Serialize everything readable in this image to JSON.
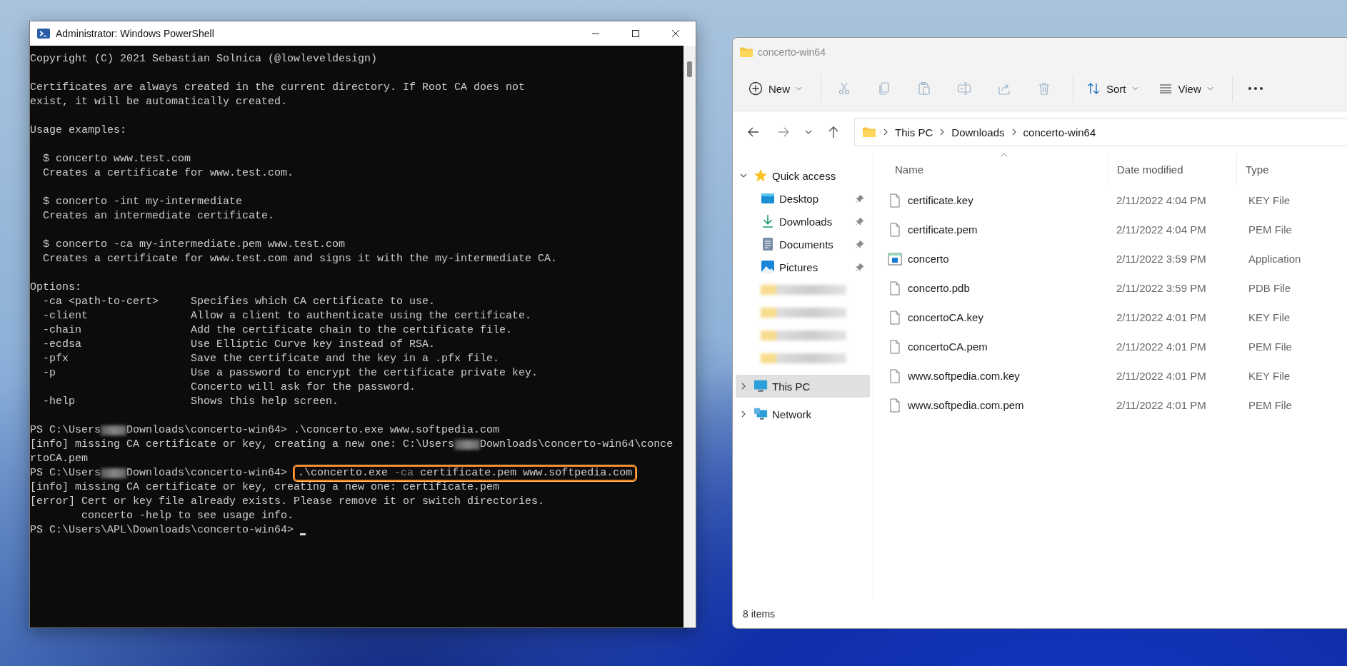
{
  "terminal": {
    "title": "Administrator: Windows PowerShell",
    "lines": [
      {
        "kind": "text",
        "parts": [
          {
            "kind": "text",
            "text": "Copyright (C) 2021 Sebastian Solnica (@lowleveldesign)"
          }
        ]
      },
      {
        "kind": "blank"
      },
      {
        "kind": "text",
        "parts": [
          {
            "kind": "text",
            "text": "Certificates are always created in the current directory. If Root CA does not"
          }
        ]
      },
      {
        "kind": "text",
        "parts": [
          {
            "kind": "text",
            "text": "exist, it will be automatically created."
          }
        ]
      },
      {
        "kind": "blank"
      },
      {
        "kind": "text",
        "parts": [
          {
            "kind": "text",
            "text": "Usage examples:"
          }
        ]
      },
      {
        "kind": "blank"
      },
      {
        "kind": "text",
        "parts": [
          {
            "kind": "text",
            "text": "  $ concerto www.test.com"
          }
        ]
      },
      {
        "kind": "text",
        "parts": [
          {
            "kind": "text",
            "text": "  Creates a certificate for www.test.com."
          }
        ]
      },
      {
        "kind": "blank"
      },
      {
        "kind": "text",
        "parts": [
          {
            "kind": "text",
            "text": "  $ concerto -int my-intermediate"
          }
        ]
      },
      {
        "kind": "text",
        "parts": [
          {
            "kind": "text",
            "text": "  Creates an intermediate certificate."
          }
        ]
      },
      {
        "kind": "blank"
      },
      {
        "kind": "text",
        "parts": [
          {
            "kind": "text",
            "text": "  $ concerto -ca my-intermediate.pem www.test.com"
          }
        ]
      },
      {
        "kind": "text",
        "parts": [
          {
            "kind": "text",
            "text": "  Creates a certificate for www.test.com and signs it with the my-intermediate CA."
          }
        ]
      },
      {
        "kind": "blank"
      },
      {
        "kind": "text",
        "parts": [
          {
            "kind": "text",
            "text": "Options:"
          }
        ]
      },
      {
        "kind": "text",
        "parts": [
          {
            "kind": "text",
            "text": "  -ca <path-to-cert>     Specifies which CA certificate to use."
          }
        ]
      },
      {
        "kind": "text",
        "parts": [
          {
            "kind": "text",
            "text": "  -client                Allow a client to authenticate using the certificate."
          }
        ]
      },
      {
        "kind": "text",
        "parts": [
          {
            "kind": "text",
            "text": "  -chain                 Add the certificate chain to the certificate file."
          }
        ]
      },
      {
        "kind": "text",
        "parts": [
          {
            "kind": "text",
            "text": "  -ecdsa                 Use Elliptic Curve key instead of RSA."
          }
        ]
      },
      {
        "kind": "text",
        "parts": [
          {
            "kind": "text",
            "text": "  -pfx                   Save the certificate and the key in a .pfx file."
          }
        ]
      },
      {
        "kind": "text",
        "parts": [
          {
            "kind": "text",
            "text": "  -p                     Use a password to encrypt the certificate private key."
          }
        ]
      },
      {
        "kind": "text",
        "parts": [
          {
            "kind": "text",
            "text": "                         Concerto will ask for the password."
          }
        ]
      },
      {
        "kind": "text",
        "parts": [
          {
            "kind": "text",
            "text": "  -help                  Shows this help screen."
          }
        ]
      },
      {
        "kind": "blank"
      },
      {
        "kind": "text",
        "parts": [
          {
            "kind": "text",
            "text": "PS C:\\Users"
          },
          {
            "kind": "redacted"
          },
          {
            "kind": "text",
            "text": "Downloads\\concerto-win64> .\\concerto.exe www.softpedia.com"
          }
        ]
      },
      {
        "kind": "text",
        "parts": [
          {
            "kind": "text",
            "text": "[info] missing CA certificate or key, creating a new one: C:\\Users"
          },
          {
            "kind": "redacted"
          },
          {
            "kind": "text",
            "text": "Downloads\\concerto-win64\\conce"
          }
        ]
      },
      {
        "kind": "text",
        "parts": [
          {
            "kind": "text",
            "text": "rtoCA.pem"
          }
        ]
      },
      {
        "kind": "text",
        "parts": [
          {
            "kind": "text",
            "text": "PS C:\\Users"
          },
          {
            "kind": "redacted"
          },
          {
            "kind": "text",
            "text": "Downloads\\concerto-win64> "
          },
          {
            "kind": "command",
            "highlighted": true,
            "segments": [
              {
                "text": ".\\concerto.exe ",
                "dim": false
              },
              {
                "text": "-ca",
                "dim": true
              },
              {
                "text": " certificate.pem www.softpedia.com",
                "dim": false
              }
            ]
          }
        ]
      },
      {
        "kind": "text",
        "parts": [
          {
            "kind": "text",
            "text": "[info] missing CA certificate or key, creating a new one: certificate.pem"
          }
        ]
      },
      {
        "kind": "text",
        "parts": [
          {
            "kind": "text",
            "text": "[error] Cert or key file already exists. Please remove it or switch directories."
          }
        ]
      },
      {
        "kind": "text",
        "parts": [
          {
            "kind": "text",
            "text": "        concerto -help to see usage info."
          }
        ]
      },
      {
        "kind": "text",
        "parts": [
          {
            "kind": "text",
            "text": "PS C:\\Users\\APL\\Downloads\\concerto-win64> "
          },
          {
            "kind": "cursor"
          }
        ]
      }
    ]
  },
  "explorer": {
    "title": "concerto-win64",
    "toolbar": [
      {
        "kind": "new",
        "label": "New",
        "disabled": false
      },
      {
        "kind": "cut",
        "disabled": true
      },
      {
        "kind": "copy",
        "disabled": true
      },
      {
        "kind": "paste",
        "disabled": true
      },
      {
        "kind": "rename",
        "disabled": true
      },
      {
        "kind": "share",
        "disabled": true
      },
      {
        "kind": "delete",
        "disabled": true
      },
      {
        "kind": "sort",
        "label": "Sort",
        "disabled": false
      },
      {
        "kind": "view",
        "label": "View",
        "disabled": false
      },
      {
        "kind": "more",
        "disabled": false
      }
    ],
    "breadcrumb": [
      "This PC",
      "Downloads",
      "concerto-win64"
    ],
    "sidebar": [
      {
        "kind": "quick",
        "label": "Quick access",
        "expanded": true,
        "selected": false
      },
      {
        "kind": "desktop",
        "label": "Desktop",
        "pinned": true,
        "selected": false
      },
      {
        "kind": "downloads",
        "label": "Downloads",
        "pinned": true,
        "selected": false
      },
      {
        "kind": "documents",
        "label": "Documents",
        "pinned": true,
        "selected": false
      },
      {
        "kind": "pictures",
        "label": "Pictures",
        "pinned": true,
        "selected": false
      },
      {
        "kind": "redacted",
        "selected": false
      },
      {
        "kind": "redacted",
        "selected": false
      },
      {
        "kind": "redacted",
        "selected": false
      },
      {
        "kind": "redacted",
        "selected": false
      },
      {
        "kind": "pc",
        "label": "This PC",
        "expanded": false,
        "selected": true
      },
      {
        "kind": "network",
        "label": "Network",
        "expanded": false,
        "selected": false
      }
    ],
    "columns": [
      "Name",
      "Date modified",
      "Type"
    ],
    "files": [
      {
        "kind": "file",
        "name": "certificate.key",
        "date": "2/11/2022 4:04 PM",
        "type": "KEY File"
      },
      {
        "kind": "file",
        "name": "certificate.pem",
        "date": "2/11/2022 4:04 PM",
        "type": "PEM File"
      },
      {
        "kind": "app",
        "name": "concerto",
        "date": "2/11/2022 3:59 PM",
        "type": "Application"
      },
      {
        "kind": "file",
        "name": "concerto.pdb",
        "date": "2/11/2022 3:59 PM",
        "type": "PDB File"
      },
      {
        "kind": "file",
        "name": "concertoCA.key",
        "date": "2/11/2022 4:01 PM",
        "type": "KEY File"
      },
      {
        "kind": "file",
        "name": "concertoCA.pem",
        "date": "2/11/2022 4:01 PM",
        "type": "PEM File"
      },
      {
        "kind": "file",
        "name": "www.softpedia.com.key",
        "date": "2/11/2022 4:01 PM",
        "type": "KEY File"
      },
      {
        "kind": "file",
        "name": "www.softpedia.com.pem",
        "date": "2/11/2022 4:01 PM",
        "type": "PEM File"
      }
    ],
    "status": "8 items"
  }
}
